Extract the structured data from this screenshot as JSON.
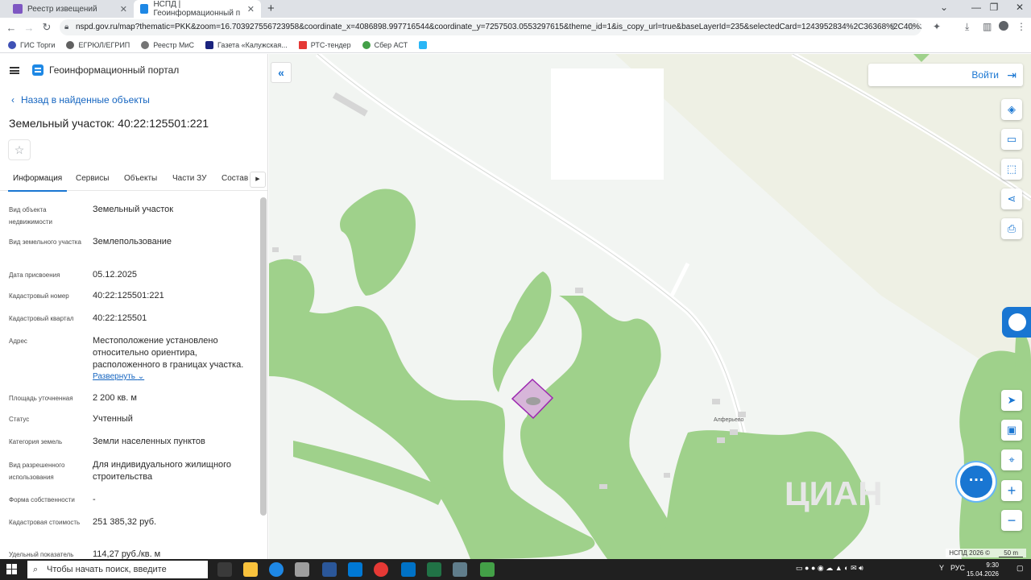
{
  "browser": {
    "tabs": [
      {
        "title": "Реестр извещений"
      },
      {
        "title": "НСПД | Геоинформационный п"
      }
    ],
    "url": "nspd.gov.ru/map?thematic=PKK&zoom=16.703927556723958&coordinate_x=4086898.997716544&coordinate_y=7257503.0553297615&theme_id=1&is_copy_url=true&baseLayerId=235&selectedCard=1243952834%2C36368%2C40%3A22%...",
    "bookmarks": [
      {
        "label": "ГИС Торги"
      },
      {
        "label": "ЕГРЮЛ/ЕГРИП"
      },
      {
        "label": "Реестр МиС"
      },
      {
        "label": "Газета «Калужская..."
      },
      {
        "label": "РТС-тендер"
      },
      {
        "label": "Сбер АСТ"
      }
    ]
  },
  "portal": {
    "name": "Геоинформационный портал",
    "back_link": "Назад в найденные объекты",
    "title": "Земельный участок: 40:22:125501:221"
  },
  "panel_tabs": [
    "Информация",
    "Сервисы",
    "Объекты",
    "Части ЗУ",
    "Состав"
  ],
  "fields": [
    {
      "label": "Вид объекта недвижимости",
      "value": "Земельный участок"
    },
    {
      "label": "Вид земельного участка",
      "value": "Землепользование"
    },
    {
      "label": "Дата присвоения",
      "value": "05.12.2025"
    },
    {
      "label": "Кадастровый номер",
      "value": "40:22:125501:221"
    },
    {
      "label": "Кадастровый квартал",
      "value": "40:22:125501"
    },
    {
      "label": "Адрес",
      "value": "Местоположение установлено относительно ориентира, расположенного в границах участка."
    },
    {
      "label": "Площадь уточненная",
      "value": "2 200 кв. м"
    },
    {
      "label": "Статус",
      "value": "Учтенный"
    },
    {
      "label": "Категория земель",
      "value": "Земли населенных пунктов"
    },
    {
      "label": "Вид разрешенного использования",
      "value": "Для индивидуального жилищного строительства"
    },
    {
      "label": "Форма собственности",
      "value": "-"
    },
    {
      "label": "Кадастровая стоимость",
      "value": "251 385,32 руб."
    },
    {
      "label": "Удельный показатель",
      "value": "114,27 руб./кв. м"
    }
  ],
  "expand_label": "Развернуть",
  "map": {
    "login_label": "Войти",
    "place_label": "Алферьево",
    "footer": "НСПД 2026 ©",
    "scale": "50 m",
    "watermark": "ЦИАН"
  },
  "taskbar": {
    "search_placeholder": "Чтобы начать поиск, введите",
    "lang": "РУС",
    "time": "9:30",
    "date": "15.04.2026"
  },
  "colors": {
    "accent": "#1976d2",
    "forest": "#9fd18b",
    "parcel_border": "#9c27b0",
    "parcel_fill": "#d7b6d9"
  }
}
